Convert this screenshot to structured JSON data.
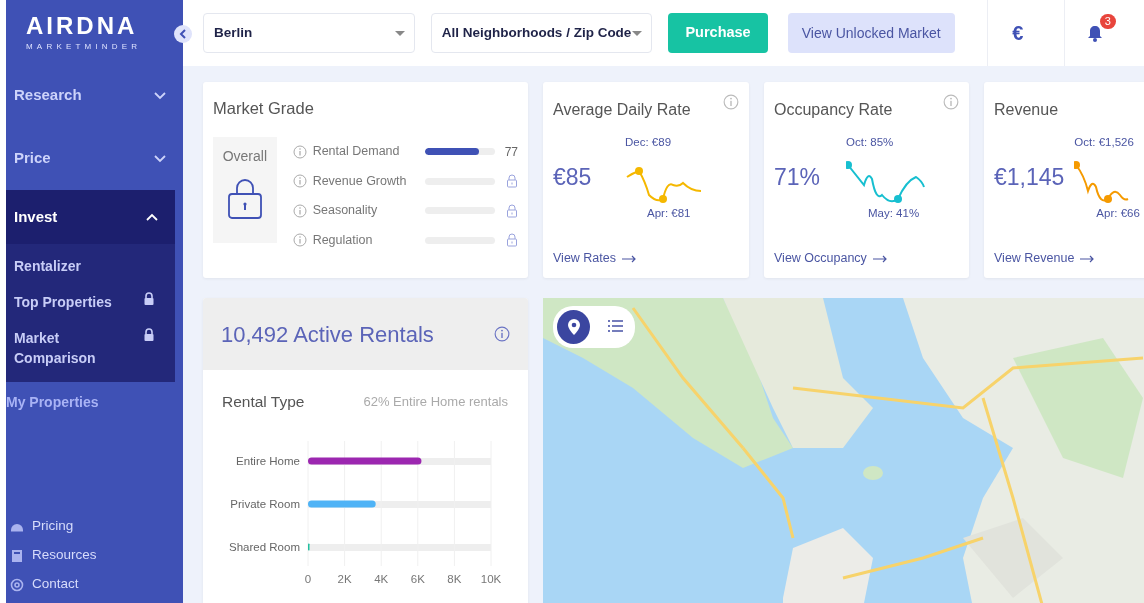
{
  "sidebar": {
    "logo": "AIRDNA",
    "logo_subtitle": "MARKETMINDER",
    "items": [
      {
        "kind": "group",
        "label": "Research",
        "expanded": false,
        "selected": false
      },
      {
        "kind": "group",
        "label": "Price",
        "expanded": false,
        "selected": false
      },
      {
        "kind": "group",
        "label": "Invest",
        "expanded": true,
        "selected": true,
        "children": [
          {
            "label": "Rentalizer",
            "locked": false
          },
          {
            "label": "Top Properties",
            "locked": true
          },
          {
            "label": "Market Comparison",
            "locked": true
          }
        ]
      },
      {
        "kind": "link",
        "label": "My Properties"
      }
    ],
    "footer_links": [
      {
        "label": "Pricing"
      },
      {
        "label": "Resources"
      },
      {
        "label": "Contact"
      }
    ]
  },
  "topbar": {
    "market_select": {
      "value": "Berlin"
    },
    "area_select": {
      "value": "All Neighborhoods / Zip Code"
    },
    "buttons": [
      {
        "kind": "primary",
        "label": "Purchase"
      },
      {
        "kind": "secondary",
        "label": "View Unlocked Market"
      }
    ],
    "currency": "€",
    "notifications": "3"
  },
  "market_grade": {
    "title": "Market Grade",
    "overall": "Overall",
    "rows": [
      {
        "label": "Rental Demand",
        "locked": false,
        "level": 0.77,
        "reading": "77"
      },
      {
        "label": "Revenue Growth",
        "locked": true
      },
      {
        "label": "Seasonality",
        "locked": true
      },
      {
        "label": "Regulation",
        "locked": true
      }
    ]
  },
  "metrics": [
    {
      "title": "Average Daily Rate",
      "info": true,
      "value": "€85",
      "high": "Dec: €89",
      "low": "Apr: €81",
      "color": "#f5b800",
      "link": "View Rates"
    },
    {
      "title": "Occupancy Rate",
      "info": true,
      "value": "71%",
      "high": "Oct: 85%",
      "low": "May: 41%",
      "color": "#17bfd0",
      "link": "View Occupancy"
    },
    {
      "title": "Revenue",
      "info": false,
      "value": "€1,145",
      "high": "Oct: €1,526",
      "low": "Apr: €66",
      "color": "#f59a00",
      "link": "View Revenue"
    }
  ],
  "active_rentals": {
    "title": "10,492 Active Rentals",
    "rental_type": {
      "title": "Rental Type",
      "summary": "62% Entire Home rentals",
      "chart_data": {
        "type": "bar",
        "orientation": "horizontal",
        "grid": true,
        "categories": [
          "Entire Home",
          "Private Room",
          "Shared Room"
        ],
        "series": [
          {
            "colors": [
              "#9c27b0",
              "#4fb3f6",
              "#1fbf9f"
            ],
            "values": [
              6200,
              3700,
              80
            ]
          }
        ],
        "xlim": [
          0,
          10000
        ],
        "xticks": [
          {
            "value": 0,
            "label": "0"
          },
          {
            "value": 2000,
            "label": "2K"
          },
          {
            "value": 4000,
            "label": "4K"
          },
          {
            "value": 6000,
            "label": "6K"
          },
          {
            "value": 8000,
            "label": "8K"
          },
          {
            "value": 10000,
            "label": "10K"
          }
        ]
      }
    }
  },
  "map": {
    "kind": "picture",
    "view_options": [
      {
        "selected": true
      },
      {
        "selected": false
      }
    ]
  }
}
